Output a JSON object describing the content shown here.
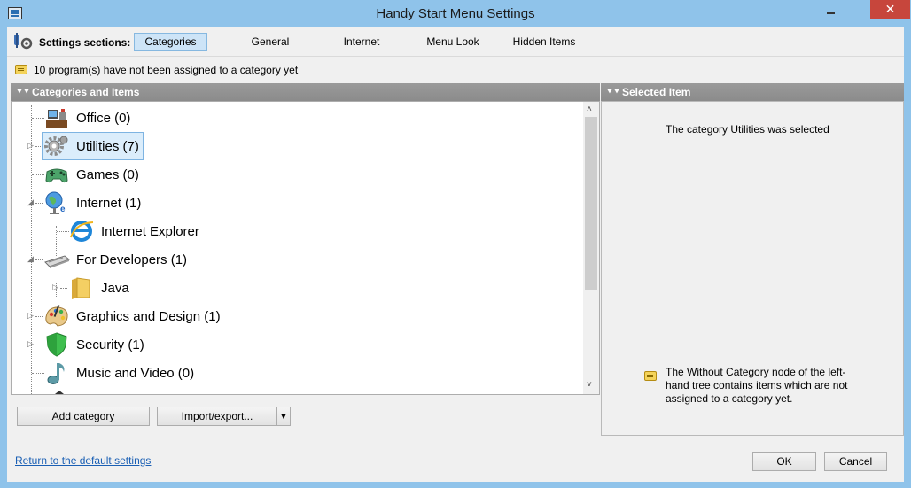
{
  "window": {
    "title": "Handy Start Menu Settings",
    "minimize": "minimize",
    "close": "✕"
  },
  "sections": {
    "label": "Settings sections:",
    "tabs": [
      {
        "label": "Categories",
        "active": true
      },
      {
        "label": "General",
        "active": false
      },
      {
        "label": "Internet",
        "active": false
      },
      {
        "label": "Menu Look",
        "active": false
      },
      {
        "label": "Hidden Items",
        "active": false
      }
    ]
  },
  "notice": {
    "text": "10 program(s) have not been assigned to a category yet"
  },
  "left_panel": {
    "header": "Categories and Items",
    "tree": [
      {
        "label": "Office (0)",
        "icon": "office-icon"
      },
      {
        "label": "Utilities (7)",
        "icon": "gear-icon",
        "selected": true
      },
      {
        "label": "Games (0)",
        "icon": "gamepad-icon"
      },
      {
        "label": "Internet (1)",
        "icon": "globe-icon"
      },
      {
        "label": "Internet Explorer",
        "icon": "internet-explorer-icon"
      },
      {
        "label": "For Developers (1)",
        "icon": "keyboard-icon"
      },
      {
        "label": "Java",
        "icon": "folder-icon"
      },
      {
        "label": "Graphics and Design (1)",
        "icon": "palette-icon"
      },
      {
        "label": "Security (1)",
        "icon": "shield-icon"
      },
      {
        "label": "Music and Video (0)",
        "icon": "music-note-icon"
      }
    ],
    "add_category": "Add category",
    "import_export": "Import/export..."
  },
  "right_panel": {
    "header": "Selected Item",
    "selected_text": "The category Utilities was selected",
    "hint_text": "The Without Category node of the left-hand tree contains items which are not assigned to a category yet."
  },
  "footer": {
    "reset_link": "Return to the default settings",
    "ok": "OK",
    "cancel": "Cancel"
  },
  "colors": {
    "title_bar": "#8fc3ea",
    "close_button": "#c7463c",
    "selection": "#dbedfb",
    "panel_header": "#8b8b8b"
  }
}
